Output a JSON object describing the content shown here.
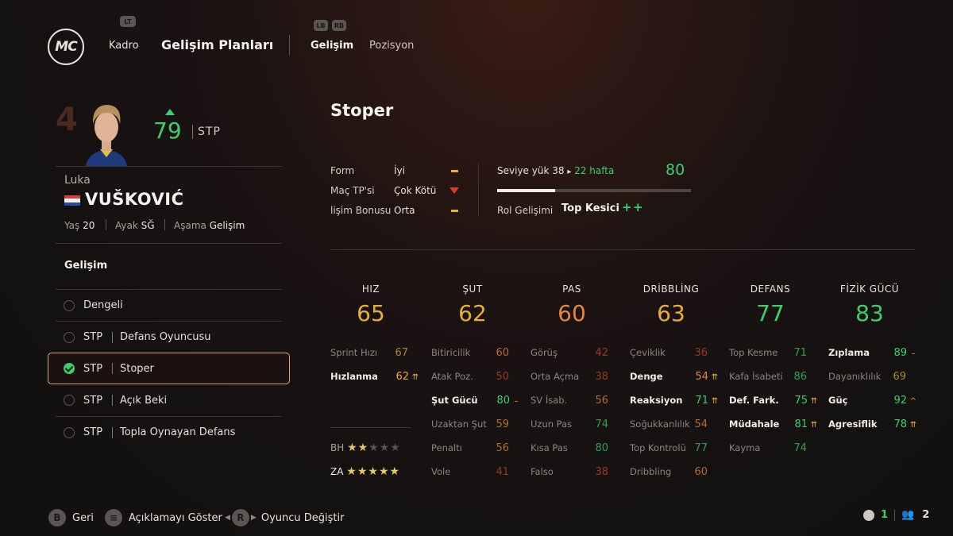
{
  "header": {
    "logo": "MC",
    "lt_badge": "LT",
    "tab_squad": "Kadro",
    "tab_plans": "Gelişim Planları",
    "lb_badge": "LB",
    "rb_badge": "RB",
    "subtab_dev": "Gelişim",
    "subtab_position": "Pozisyon"
  },
  "player": {
    "number": "4",
    "overall": "79",
    "position": "STP",
    "first_name": "Luka",
    "last_name": "VUŠKOVIĆ",
    "age_label": "Yaş",
    "age": "20",
    "foot_label": "Ayak",
    "foot": "SĞ",
    "stage_label": "Aşama",
    "stage": "Gelişim"
  },
  "development": {
    "title": "Gelişim",
    "plans": [
      {
        "pos": "",
        "label": "Dengeli"
      },
      {
        "pos": "STP",
        "label": "Defans Oyuncusu"
      },
      {
        "pos": "STP",
        "label": "Stoper"
      },
      {
        "pos": "STP",
        "label": "Açık Beki"
      },
      {
        "pos": "STP",
        "label": "Topla Oynayan Defans"
      }
    ]
  },
  "role": {
    "title": "Stoper",
    "form_label": "Form",
    "form_value": "İyi",
    "match_label": "Maç TP'si",
    "match_value": "Çok Kötü",
    "bonus_label": "lişim Bonusu",
    "bonus_value": "Orta",
    "level_label": "Seviye yük",
    "level_value": "38",
    "level_arrow": "▸",
    "weeks": "22 hafta",
    "target": "80",
    "level_progress": 0.3,
    "role_dev_label": "Rol Gelişimi",
    "role_dev_value": "Top Kesici"
  },
  "categories": [
    {
      "name": "HIZ",
      "value": "65",
      "color": "#e8b030"
    },
    {
      "name": "ŞUT",
      "value": "62",
      "color": "#e8b030"
    },
    {
      "name": "PAS",
      "value": "60",
      "color": "#e8863a"
    },
    {
      "name": "DRİBBLİNG",
      "value": "63",
      "color": "#e8b030"
    },
    {
      "name": "DEFANS",
      "value": "77",
      "color": "#3ad06a"
    },
    {
      "name": "FİZİK GÜCÜ",
      "value": "83",
      "color": "#3ad06a"
    }
  ],
  "attributes": {
    "pace": [
      {
        "name": "Sprint Hızı",
        "value": "67",
        "hl": false,
        "cls": "c-dyellow",
        "ind": ""
      },
      {
        "name": "Hızlanma",
        "value": "62",
        "hl": true,
        "cls": "c-yellow",
        "ind": "⇈"
      }
    ],
    "shooting": [
      {
        "name": "Bitiricilik",
        "value": "60",
        "hl": false,
        "cls": "c-dorange",
        "ind": ""
      },
      {
        "name": "Atak Poz.",
        "value": "50",
        "hl": false,
        "cls": "c-dred",
        "ind": ""
      },
      {
        "name": "Şut Gücü",
        "value": "80",
        "hl": true,
        "cls": "c-green",
        "ind": "–"
      },
      {
        "name": "Uzaktan Şut",
        "value": "59",
        "hl": false,
        "cls": "c-dorange",
        "ind": ""
      },
      {
        "name": "Penaltı",
        "value": "56",
        "hl": false,
        "cls": "c-dorange",
        "ind": ""
      },
      {
        "name": "Vole",
        "value": "41",
        "hl": false,
        "cls": "c-dred",
        "ind": ""
      }
    ],
    "passing": [
      {
        "name": "Görüş",
        "value": "42",
        "hl": false,
        "cls": "c-dred",
        "ind": ""
      },
      {
        "name": "Orta Açma",
        "value": "38",
        "hl": false,
        "cls": "c-dred",
        "ind": ""
      },
      {
        "name": "SV İsab.",
        "value": "56",
        "hl": false,
        "cls": "c-dorange",
        "ind": ""
      },
      {
        "name": "Uzun Pas",
        "value": "74",
        "hl": false,
        "cls": "c-dgreen",
        "ind": ""
      },
      {
        "name": "Kısa Pas",
        "value": "80",
        "hl": false,
        "cls": "c-dgreen",
        "ind": ""
      },
      {
        "name": "Falso",
        "value": "38",
        "hl": false,
        "cls": "c-dred",
        "ind": ""
      }
    ],
    "dribbling": [
      {
        "name": "Çeviklik",
        "value": "36",
        "hl": false,
        "cls": "c-dred",
        "ind": ""
      },
      {
        "name": "Denge",
        "value": "54",
        "hl": true,
        "cls": "c-orange",
        "ind": "⇈"
      },
      {
        "name": "Reaksiyon",
        "value": "71",
        "hl": true,
        "cls": "c-green",
        "ind": "⇈"
      },
      {
        "name": "Soğukkanlılık",
        "value": "54",
        "hl": false,
        "cls": "c-dorange",
        "ind": ""
      },
      {
        "name": "Top Kontrolü",
        "value": "77",
        "hl": false,
        "cls": "c-dgreen",
        "ind": ""
      },
      {
        "name": "Dribbling",
        "value": "60",
        "hl": false,
        "cls": "c-dorange",
        "ind": ""
      }
    ],
    "defending": [
      {
        "name": "Top Kesme",
        "value": "71",
        "hl": false,
        "cls": "c-dgreen",
        "ind": ""
      },
      {
        "name": "Kafa İsabeti",
        "value": "86",
        "hl": false,
        "cls": "c-dgreen",
        "ind": ""
      },
      {
        "name": "Def. Fark.",
        "value": "75",
        "hl": true,
        "cls": "c-green",
        "ind": "⇈"
      },
      {
        "name": "Müdahale",
        "value": "81",
        "hl": true,
        "cls": "c-green",
        "ind": "⇈"
      },
      {
        "name": "Kayma",
        "value": "74",
        "hl": false,
        "cls": "c-dgreen",
        "ind": ""
      }
    ],
    "physical": [
      {
        "name": "Zıplama",
        "value": "89",
        "hl": true,
        "cls": "c-green",
        "ind": "–"
      },
      {
        "name": "Dayanıklılık",
        "value": "69",
        "hl": false,
        "cls": "c-dyellow",
        "ind": ""
      },
      {
        "name": "Güç",
        "value": "92",
        "hl": true,
        "cls": "c-green",
        "ind": "^"
      },
      {
        "name": "Agresiflik",
        "value": "78",
        "hl": true,
        "cls": "c-green",
        "ind": "⇈"
      }
    ]
  },
  "skills": {
    "weak_foot_label": "BH",
    "weak_foot": 2,
    "skill_moves_label": "ZA",
    "skill_moves": 5
  },
  "footer": {
    "back_btn": "B",
    "back_label": "Geri",
    "desc_btn": "≡",
    "desc_label": "Açıklamayı Göster",
    "change_btn": "R",
    "change_label": "Oyuncu Değiştir",
    "count_a": "1",
    "count_b": "2"
  }
}
